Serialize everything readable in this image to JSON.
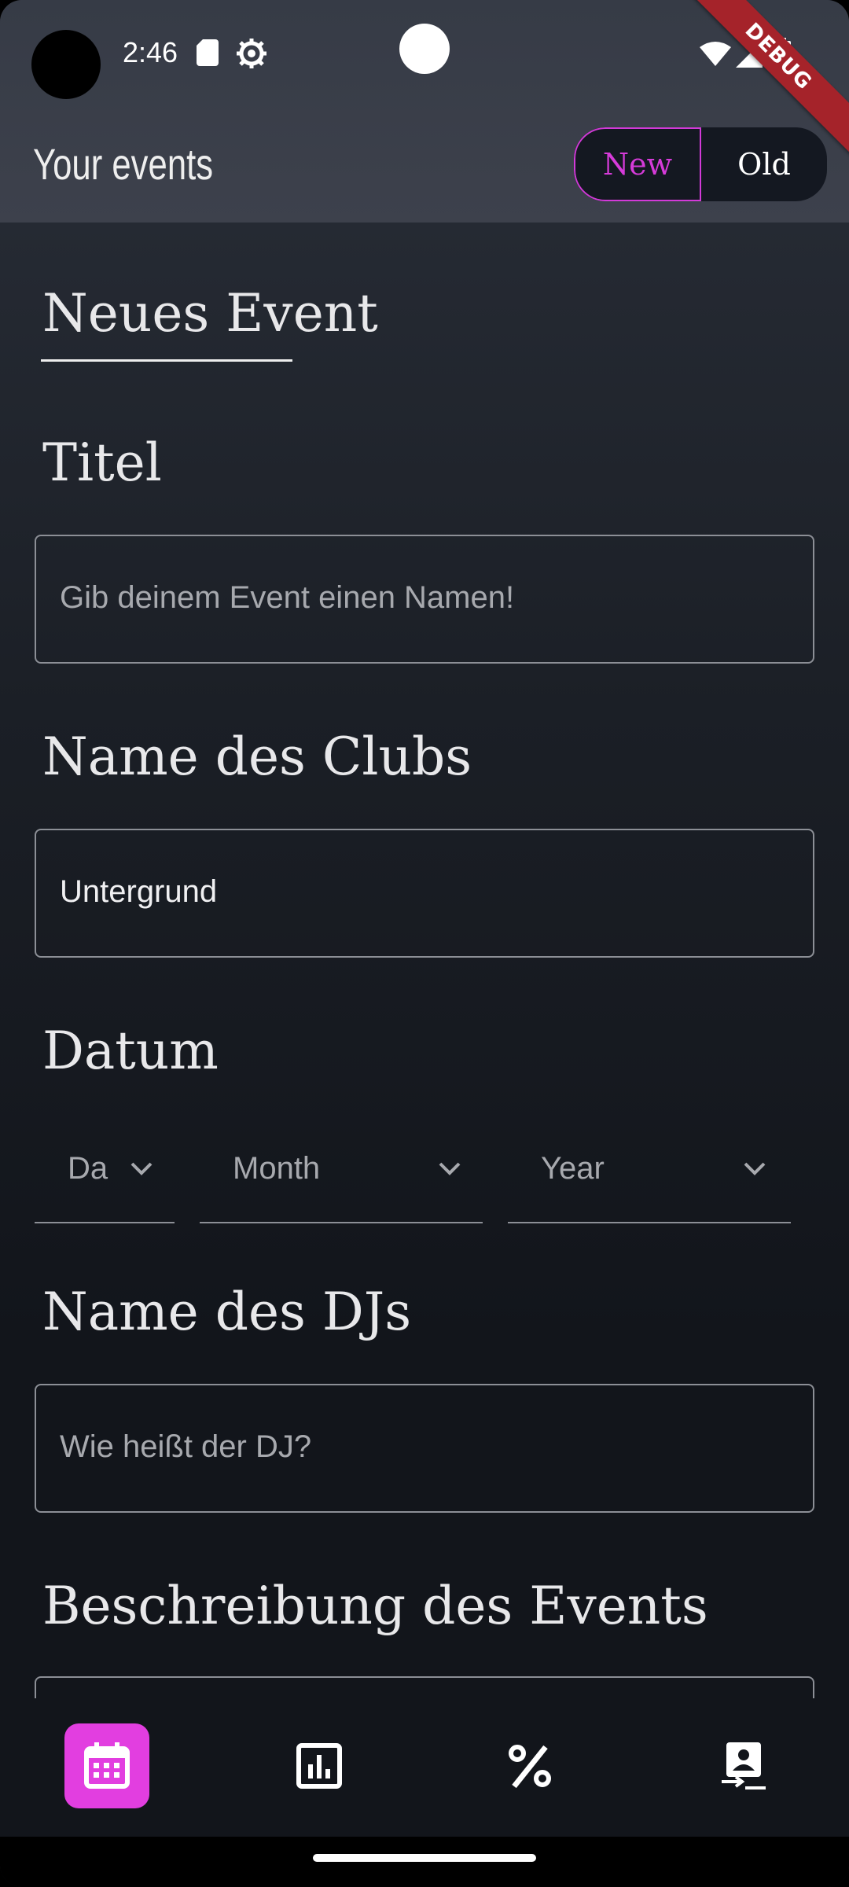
{
  "status_bar": {
    "time": "2:46"
  },
  "debug_banner": "DEBUG",
  "app_bar": {
    "title": "Your events",
    "toggle": {
      "new_label": "New",
      "old_label": "Old",
      "selected": "New"
    }
  },
  "form": {
    "tab_title": "Neues Event",
    "title_section": {
      "label": "Titel",
      "placeholder": "Gib deinem Event einen Namen!"
    },
    "club_section": {
      "label": "Name des Clubs",
      "value": "Untergrund"
    },
    "date_section": {
      "label": "Datum",
      "day_label": "Da",
      "month_label": "Month",
      "year_label": "Year"
    },
    "dj_section": {
      "label": "Name des DJs",
      "placeholder": "Wie heißt der DJ?"
    },
    "description_section": {
      "label": "Beschreibung des Events"
    }
  },
  "bottom_nav": {
    "items": [
      {
        "icon": "calendar-icon",
        "active": true
      },
      {
        "icon": "bar-chart-icon",
        "active": false
      },
      {
        "icon": "percent-icon",
        "active": false
      },
      {
        "icon": "contact-switch-icon",
        "active": false
      }
    ]
  },
  "colors": {
    "accent": "#e23ee0",
    "toggle_accent_text": "#d63bd9",
    "debug": "#a5232a"
  }
}
